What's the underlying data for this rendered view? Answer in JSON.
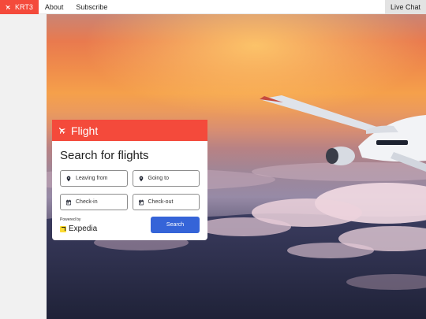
{
  "nav": {
    "brand": "KRT3",
    "links": [
      "About",
      "Subscribe"
    ],
    "live_chat": "Live Chat"
  },
  "widget": {
    "header": "Flight",
    "title": "Search for flights",
    "leaving_from": "Leaving from",
    "going_to": "Going to",
    "check_in": "Check-in",
    "check_out": "Check-out",
    "powered_by": "Powered by",
    "provider": "Expedia",
    "search_label": "Search"
  },
  "colors": {
    "brand_red": "#f44a3b",
    "search_blue": "#3564d8",
    "expedia_yellow": "#fddb32"
  },
  "icons": {
    "brand": "airplane-icon",
    "header": "airplane-icon",
    "leaving_from": "location-pin-icon",
    "going_to": "location-pin-icon",
    "check_in": "calendar-icon",
    "check_out": "calendar-icon"
  }
}
